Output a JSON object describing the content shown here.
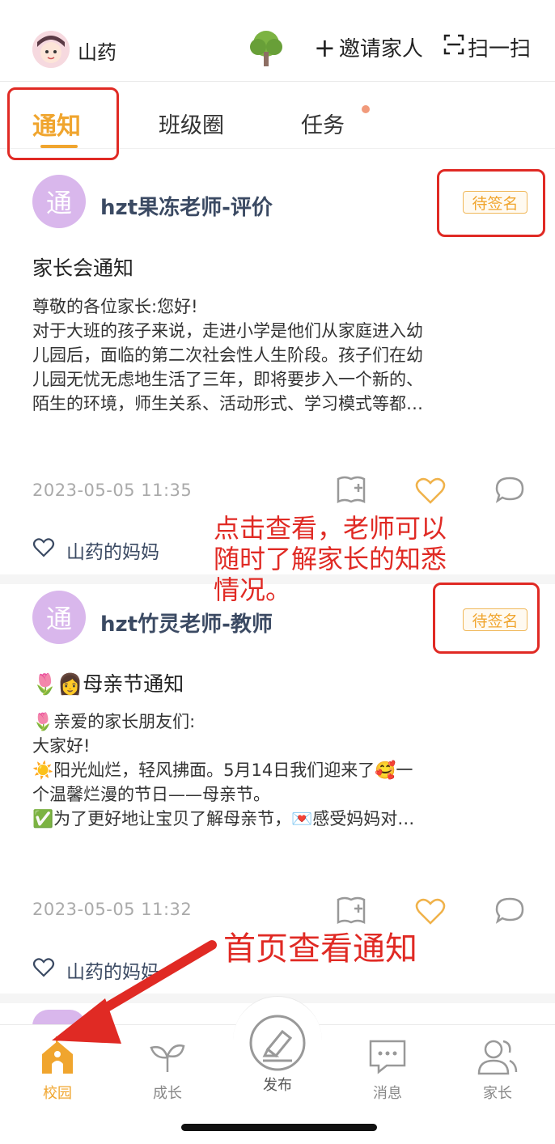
{
  "header": {
    "username": "山药",
    "invite_label": "邀请家人",
    "scan_label": "扫一扫"
  },
  "tabs": [
    {
      "label": "通知",
      "active": true
    },
    {
      "label": "班级圈",
      "active": false
    },
    {
      "label": "任务",
      "active": false,
      "has_dot": true
    }
  ],
  "notices": [
    {
      "avatar_char": "通",
      "author": "hzt果冻老师-评价",
      "badge": "待签名",
      "title": "家长会通知",
      "body_lines": [
        "尊敬的各位家长:您好!",
        "对于大班的孩子来说，走进小学是他们从家庭进入幼",
        "儿园后，面临的第二次社会性人生阶段。孩子们在幼",
        "儿园无忧无虑地生活了三年，即将要步入一个新的、",
        "陌生的环境，师生关系、活动形式、学习模式等都…"
      ],
      "time": "2023-05-05  11:35",
      "liker": "山药的妈妈"
    },
    {
      "avatar_char": "通",
      "author": "hzt竹灵老师-教师",
      "badge": "待签名",
      "title": "母亲节通知",
      "title_emoji": "🌷👩",
      "body_lines": [
        "🌷亲爱的家长朋友们:",
        "大家好!",
        "☀️阳光灿烂，轻风拂面。5月14日我们迎来了🥰一",
        "个温馨烂漫的节日——母亲节。",
        "✅为了更好地让宝贝了解母亲节，💌感受妈妈对…"
      ],
      "time": "2023-05-05  11:32",
      "liker": "山药的妈妈"
    }
  ],
  "annotations": {
    "note1_lines": [
      "点击查看，老师可以",
      "随时了解家长的知悉",
      "情况。"
    ],
    "note2": "首页查看通知"
  },
  "bottom_nav": [
    {
      "label": "校园",
      "icon": "school-icon",
      "active": true
    },
    {
      "label": "成长",
      "icon": "sprout-icon",
      "active": false
    },
    {
      "label": "发布",
      "icon": "publish-icon",
      "active": false
    },
    {
      "label": "消息",
      "icon": "message-icon",
      "active": false
    },
    {
      "label": "家长",
      "icon": "parents-icon",
      "active": false
    }
  ],
  "colors": {
    "accent": "#f0a52e",
    "annotation_red": "#e02a24",
    "author_text": "#3b4a63",
    "avatar_purple": "#d9b7ec"
  }
}
